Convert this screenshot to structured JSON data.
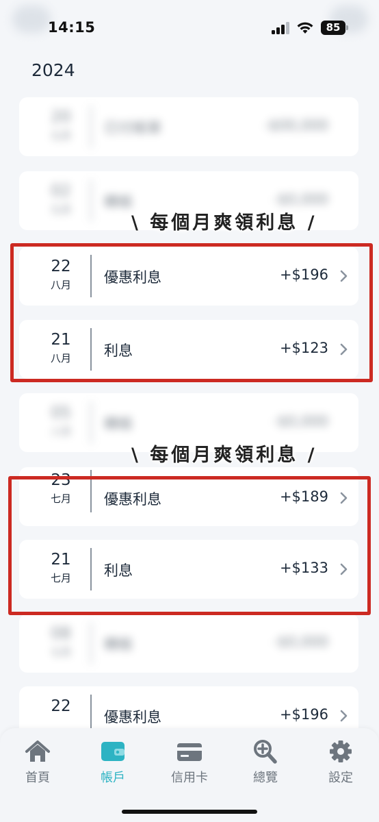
{
  "status_bar": {
    "time": "14:15",
    "battery": "85"
  },
  "year": "2024",
  "banner_text": "\\ 每個月爽領利息 /",
  "transactions": [
    {
      "day": "22",
      "month": "八月",
      "description": "優惠利息",
      "amount": "+$196"
    },
    {
      "day": "21",
      "month": "八月",
      "description": "利息",
      "amount": "+$123"
    },
    {
      "day": "23",
      "month": "七月",
      "description": "優惠利息",
      "amount": "+$189"
    },
    {
      "day": "21",
      "month": "七月",
      "description": "利息",
      "amount": "+$133"
    },
    {
      "day": "22",
      "month": "",
      "description": "優惠利息",
      "amount": "+$196"
    }
  ],
  "tabs": [
    {
      "label": "首頁",
      "icon": "home-icon",
      "active": false
    },
    {
      "label": "帳戶",
      "icon": "wallet-icon",
      "active": true
    },
    {
      "label": "信用卡",
      "icon": "credit-card-icon",
      "active": false
    },
    {
      "label": "總覽",
      "icon": "zoom-in-icon",
      "active": false
    },
    {
      "label": "設定",
      "icon": "gear-icon",
      "active": false
    }
  ],
  "colors": {
    "accent": "#2db3c3",
    "highlight": "#cc2a22",
    "text": "#1d2a3a",
    "inactive_tab": "#6d757e"
  }
}
